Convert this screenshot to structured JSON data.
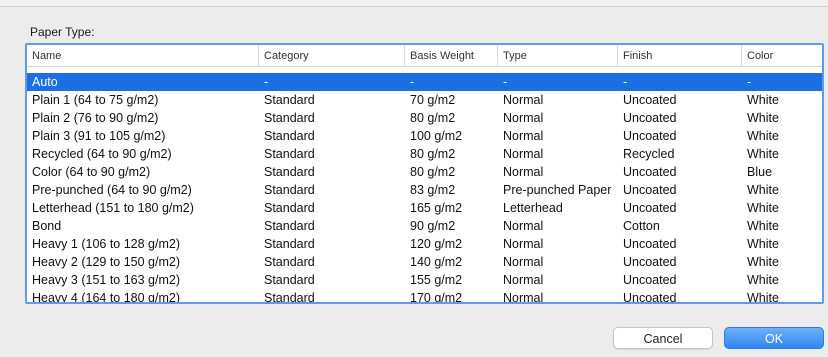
{
  "dialog": {
    "heading": "Paper Type:",
    "columns": [
      "Name",
      "Category",
      "Basis Weight",
      "Type",
      "Finish",
      "Color"
    ],
    "rows": [
      [
        "Auto",
        "-",
        "-",
        "-",
        "-",
        "-"
      ],
      [
        "Plain 1 (64 to 75 g/m2)",
        "Standard",
        "70 g/m2",
        "Normal",
        "Uncoated",
        "White"
      ],
      [
        "Plain 2 (76 to 90 g/m2)",
        "Standard",
        "80 g/m2",
        "Normal",
        "Uncoated",
        "White"
      ],
      [
        "Plain 3 (91 to 105 g/m2)",
        "Standard",
        "100 g/m2",
        "Normal",
        "Uncoated",
        "White"
      ],
      [
        "Recycled (64 to 90 g/m2)",
        "Standard",
        "80 g/m2",
        "Normal",
        "Recycled",
        "White"
      ],
      [
        "Color (64 to 90 g/m2)",
        "Standard",
        "80 g/m2",
        "Normal",
        "Uncoated",
        "Blue"
      ],
      [
        "Pre-punched (64 to 90 g/m2)",
        "Standard",
        "83 g/m2",
        "Pre-punched Paper",
        "Uncoated",
        "White"
      ],
      [
        "Letterhead (151 to 180 g/m2)",
        "Standard",
        "165 g/m2",
        "Letterhead",
        "Uncoated",
        "White"
      ],
      [
        "Bond",
        "Standard",
        "90 g/m2",
        "Normal",
        "Cotton",
        "White"
      ],
      [
        "Heavy 1 (106 to 128 g/m2)",
        "Standard",
        "120 g/m2",
        "Normal",
        "Uncoated",
        "White"
      ],
      [
        "Heavy 2 (129 to 150 g/m2)",
        "Standard",
        "140 g/m2",
        "Normal",
        "Uncoated",
        "White"
      ],
      [
        "Heavy 3 (151 to 163 g/m2)",
        "Standard",
        "155 g/m2",
        "Normal",
        "Uncoated",
        "White"
      ],
      [
        "Heavy 4 (164 to 180 g/m2)",
        "Standard",
        "170 g/m2",
        "Normal",
        "Uncoated",
        "White"
      ]
    ],
    "selected_row": 0,
    "cancel_label": "Cancel",
    "ok_label": "OK"
  },
  "colors": {
    "selection": "#1c6fe3",
    "table_focus_border": "#5f9be6",
    "ok_button": "#2f86f3"
  }
}
